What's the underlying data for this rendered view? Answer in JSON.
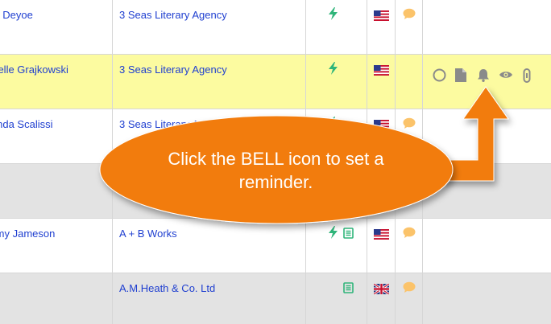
{
  "rows": [
    {
      "name": "Lori Deyoe",
      "agency": "3 Seas Literary Agency",
      "flag": "US",
      "chat": true
    },
    {
      "name": "Michelle Grajkowski",
      "agency": "3 Seas Literary Agency",
      "flag": "US",
      "chat": false
    },
    {
      "name": "Linda Scalissi",
      "agency": "3 Seas Literary Agency",
      "flag": "US",
      "chat": true
    },
    {
      "name": "Amy Jameson",
      "agency": "A + B Works",
      "flag": "US",
      "chat": true
    },
    {
      "name": "",
      "agency": "A.M.Heath & Co. Ltd",
      "flag": "UK",
      "chat": true
    }
  ],
  "callout": {
    "text": "Click the BELL icon to set a reminder.",
    "color": "#f27c0f"
  },
  "icons": {
    "quick": "lightning-icon",
    "notes": "document-list-icon",
    "actions": [
      "circle-icon",
      "document-icon",
      "bell-icon",
      "eye-icon",
      "chain-link-icon"
    ]
  },
  "colors": {
    "link": "#1f3fd0",
    "highlight_row": "#fcfba0",
    "gray_row": "#e3e3e3",
    "accent_green": "#2fb57a",
    "chat_orange": "#fbc36a"
  }
}
